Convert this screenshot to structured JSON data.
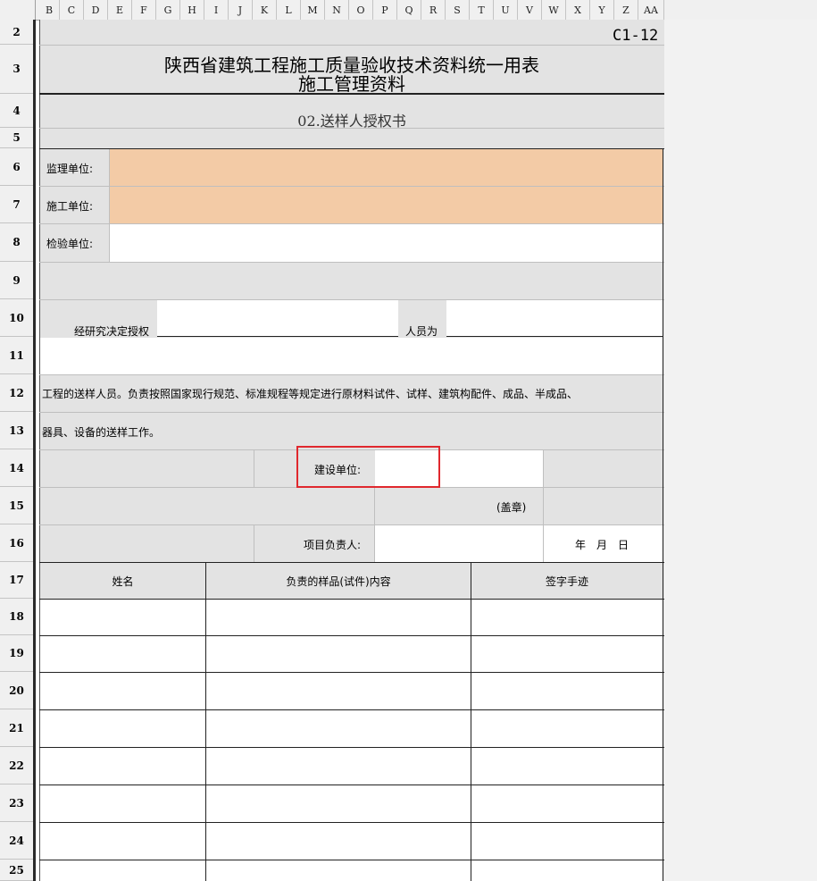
{
  "columns": [
    "B",
    "C",
    "D",
    "E",
    "F",
    "G",
    "H",
    "I",
    "J",
    "K",
    "L",
    "M",
    "N",
    "O",
    "P",
    "Q",
    "R",
    "S",
    "T",
    "U",
    "V",
    "W",
    "X",
    "Y",
    "Z",
    "AA"
  ],
  "rows": [
    "2",
    "3",
    "4",
    "5",
    "6",
    "7",
    "8",
    "9",
    "10",
    "11",
    "12",
    "13",
    "14",
    "15",
    "16",
    "17",
    "18",
    "19",
    "20",
    "21",
    "22",
    "23",
    "24",
    "25"
  ],
  "form": {
    "code": "C1-12",
    "title_line1": "陕西省建筑工程施工质量验收技术资料统一用表",
    "title_line2": "施工管理资料",
    "subtitle": "02.送样人授权书",
    "supervision_unit_label": "监理单位:",
    "construction_unit_label": "施工单位:",
    "inspection_unit_label": "检验单位:",
    "authorize_label": "经研究决定授权",
    "person_label": "人员为",
    "paragraph_line1": "工程的送样人员。负责按照国家现行规范、标准规程等规定进行原材料试件、试样、建筑构配件、成品、半成品、",
    "paragraph_line2": "器具、设备的送样工作。",
    "owner_unit_label": "建设单位:",
    "seal_label": "(盖章)",
    "project_lead_label": "项目负责人:",
    "date_label": "年　月　日"
  },
  "table": {
    "headers": [
      "姓名",
      "负责的样品(试件)内容",
      "签字手迹"
    ]
  },
  "colors": {
    "highlight": "#f3cba6",
    "selection": "#e0282e",
    "header_bg": "#f0f0f0"
  }
}
